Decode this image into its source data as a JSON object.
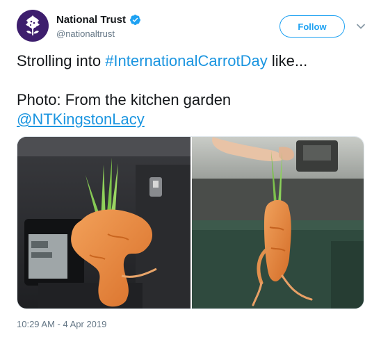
{
  "account": {
    "display_name": "National Trust",
    "handle": "@nationaltrust",
    "verified": true,
    "avatar_icon": "oak-leaf-logo-icon",
    "avatar_color": "#3d1e6d"
  },
  "follow_button": {
    "label": "Follow"
  },
  "menu": {
    "icon": "chevron-down-icon"
  },
  "tweet": {
    "line1_prefix": "Strolling into ",
    "hashtag": "#InternationalCarrotDay",
    "line1_suffix": " like...",
    "line2": "Photo: From the kitchen garden",
    "mention": "@NTKingstonLacy"
  },
  "media": {
    "photos": [
      {
        "subject": "carrot-photo-left"
      },
      {
        "subject": "carrot-photo-right"
      }
    ]
  },
  "timestamp": "10:29 AM - 4 Apr 2019",
  "colors": {
    "link": "#1b95e0",
    "follow": "#1da1f2",
    "muted": "#657786"
  }
}
